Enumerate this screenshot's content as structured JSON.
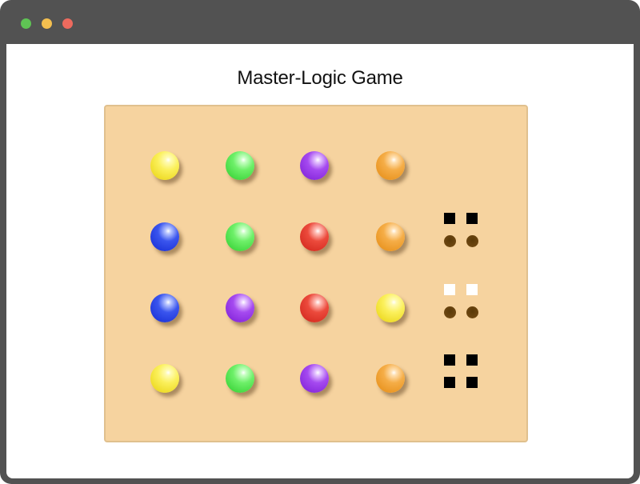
{
  "window": {
    "controls": [
      {
        "name": "zoom",
        "color": "#5fc454"
      },
      {
        "name": "minimize",
        "color": "#f4bf4f"
      },
      {
        "name": "close",
        "color": "#ed6a5e"
      }
    ]
  },
  "game": {
    "title": "Master-Logic Game",
    "board_color": "#f6d39f",
    "colors": {
      "yellow": "#fbf05c",
      "green": "#6ef069",
      "purple": "#a54af0",
      "orange": "#f5ad47",
      "blue": "#3a55ee",
      "red": "#ec4a3c"
    },
    "rows": [
      {
        "pegs": [
          "yellow",
          "green",
          "purple",
          "orange"
        ],
        "feedback": []
      },
      {
        "pegs": [
          "blue",
          "green",
          "red",
          "orange"
        ],
        "feedback": [
          "black",
          "black",
          "hole",
          "hole"
        ]
      },
      {
        "pegs": [
          "blue",
          "purple",
          "red",
          "yellow"
        ],
        "feedback": [
          "white",
          "white",
          "hole",
          "hole"
        ]
      },
      {
        "pegs": [
          "yellow",
          "green",
          "purple",
          "orange"
        ],
        "feedback": [
          "black",
          "black",
          "black",
          "black"
        ]
      }
    ]
  }
}
